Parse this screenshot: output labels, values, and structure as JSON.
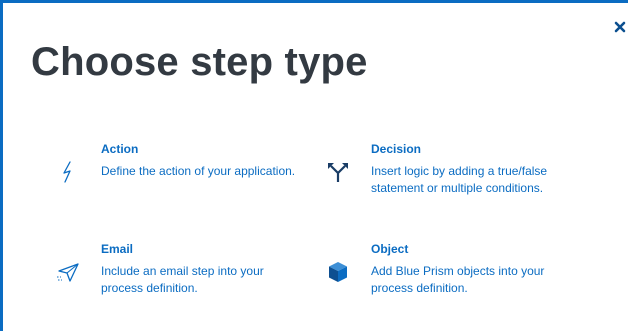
{
  "dialog": {
    "title": "Choose step type",
    "close_label": "×"
  },
  "options": [
    {
      "title": "Action",
      "description": "Define the action of your application.",
      "icon": "lightning-icon"
    },
    {
      "title": "Decision",
      "description": "Insert logic by adding a true/false statement or multiple conditions.",
      "icon": "branch-arrows-icon"
    },
    {
      "title": "Email",
      "description": "Include an email step into your process definition.",
      "icon": "paper-plane-icon"
    },
    {
      "title": "Object",
      "description": "Add Blue Prism objects into your process definition.",
      "icon": "cube-icon"
    }
  ],
  "colors": {
    "accent": "#0b6cc2",
    "title": "#333a42",
    "background": "#ffffff"
  }
}
